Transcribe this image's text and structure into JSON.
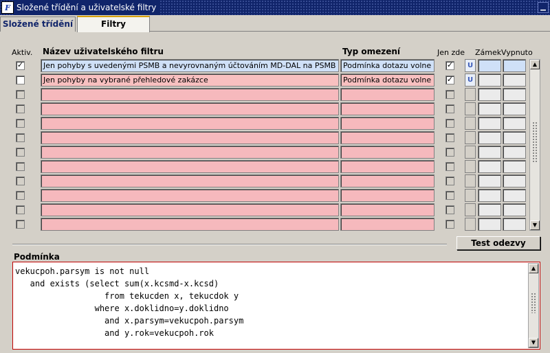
{
  "window": {
    "title": "Složené třídění a uživatelské filtry",
    "icon_name": "forms-app-icon",
    "icon_glyph": "F"
  },
  "tabs": [
    {
      "label": "Složené třídění"
    },
    {
      "label": "Filtry"
    }
  ],
  "columns": {
    "active": "Aktiv.",
    "name": "Název uživatelského filtru",
    "type": "Typ omezení",
    "only_here": "Jen zde",
    "lock": "Zámek",
    "off": "Vypnuto"
  },
  "rows": [
    {
      "active": "✓",
      "name": "Jen pohyby s uvedenými PSMB a nevyrovnaným účtováním MD-DAL na PSMB",
      "type": "Podmínka dotazu volne",
      "only_here": "✓",
      "lock": "U"
    },
    {
      "active": "",
      "name": "Jen pohyby na vybrané přehledové zakázce",
      "type": "Podmínka dotazu volne",
      "only_here": "✓",
      "lock": "U"
    },
    {
      "active": "",
      "name": "",
      "type": "",
      "only_here": "",
      "lock": ""
    },
    {
      "active": "",
      "name": "",
      "type": "",
      "only_here": "",
      "lock": ""
    },
    {
      "active": "",
      "name": "",
      "type": "",
      "only_here": "",
      "lock": ""
    },
    {
      "active": "",
      "name": "",
      "type": "",
      "only_here": "",
      "lock": ""
    },
    {
      "active": "",
      "name": "",
      "type": "",
      "only_here": "",
      "lock": ""
    },
    {
      "active": "",
      "name": "",
      "type": "",
      "only_here": "",
      "lock": ""
    },
    {
      "active": "",
      "name": "",
      "type": "",
      "only_here": "",
      "lock": ""
    },
    {
      "active": "",
      "name": "",
      "type": "",
      "only_here": "",
      "lock": ""
    },
    {
      "active": "",
      "name": "",
      "type": "",
      "only_here": "",
      "lock": ""
    },
    {
      "active": "",
      "name": "",
      "type": "",
      "only_here": "",
      "lock": ""
    }
  ],
  "test_button": "Test odezvy",
  "condition": {
    "label": "Podmínka",
    "text": "vekucpoh.parsym is not null\n   and exists (select sum(x.kcsmd-x.kcsd)\n                  from tekucden x, tekucdok y\n                where x.doklidno=y.doklidno\n                  and x.parsym=vekucpoh.parsym\n                  and y.rok=vekucpoh.rok"
  },
  "colors": {
    "titlebar": "#10246a",
    "row_fill": "#f8c0c0",
    "selected_fill": "#cfe0f7",
    "condition_border": "#c00000"
  }
}
